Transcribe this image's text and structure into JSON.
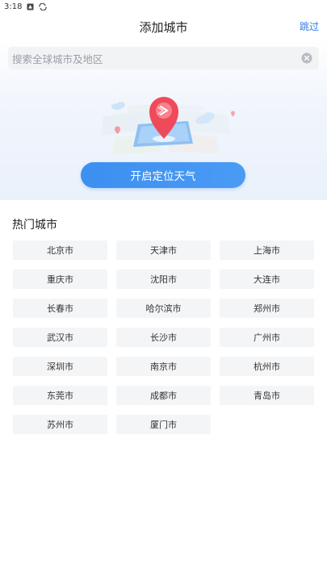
{
  "status_bar": {
    "time": "3:18",
    "icons": [
      "notification-icon",
      "sync-icon"
    ]
  },
  "header": {
    "title": "添加城市",
    "skip_label": "跳过"
  },
  "search": {
    "placeholder": "搜索全球城市及地区"
  },
  "hero": {
    "illustration": "location-pin-on-map",
    "locate_button": "开启定位天气"
  },
  "hot_cities": {
    "title": "热门城市",
    "items": [
      "北京市",
      "天津市",
      "上海市",
      "重庆市",
      "沈阳市",
      "大连市",
      "长春市",
      "哈尔滨市",
      "郑州市",
      "武汉市",
      "长沙市",
      "广州市",
      "深圳市",
      "南京市",
      "杭州市",
      "东莞市",
      "成都市",
      "青岛市",
      "苏州市",
      "厦门市"
    ]
  },
  "colors": {
    "accent": "#3d8ff0",
    "skip_link": "#2f7de1",
    "pin": "#ef4a5a"
  }
}
